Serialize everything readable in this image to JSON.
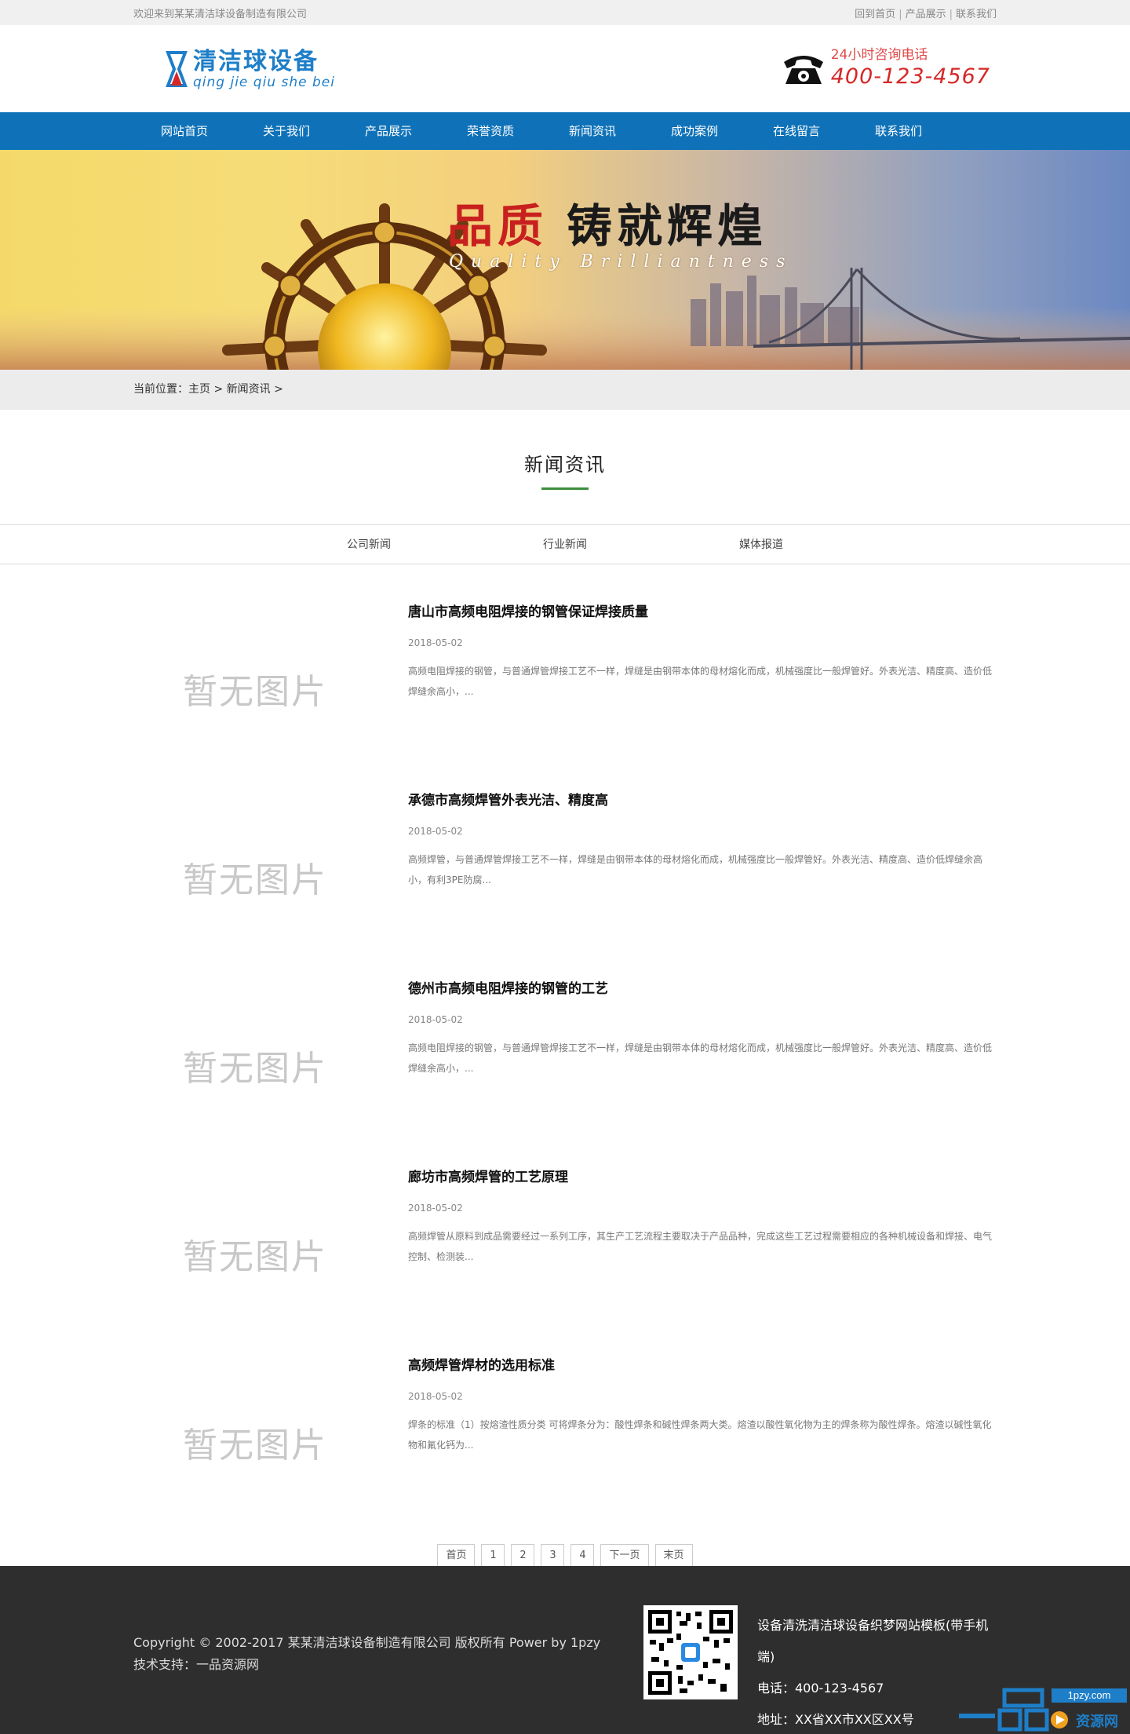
{
  "topbar": {
    "welcome": "欢迎来到某某清洁球设备制造有限公司",
    "links": [
      "回到首页",
      "产品展示",
      "联系我们"
    ]
  },
  "header": {
    "logo_cn": "清洁球设备",
    "logo_pinyin": "qing jie qiu she bei",
    "hotline_label": "24小时咨询电话",
    "hotline_number": "400-123-4567"
  },
  "nav": [
    "网站首页",
    "关于我们",
    "产品展示",
    "荣誉资质",
    "新闻资讯",
    "成功案例",
    "在线留言",
    "联系我们"
  ],
  "banner": {
    "title_red": "品质",
    "title_black": "铸就辉煌",
    "subtitle_en": "Quality Brilliantness"
  },
  "breadcrumb": "当前位置：主页 > 新闻资讯 >",
  "section": {
    "title": "新闻资讯"
  },
  "tabs": [
    "公司新闻",
    "行业新闻",
    "媒体报道"
  ],
  "news": [
    {
      "thumb": "暂无图片",
      "title": "唐山市高频电阻焊接的钢管保证焊接质量",
      "date": "2018-05-02",
      "desc": "高频电阻焊接的钢管，与普通焊管焊接工艺不一样，焊缝是由钢带本体的母材熔化而成，机械强度比一般焊管好。外表光洁、精度高、造价低焊缝余高小，..."
    },
    {
      "thumb": "暂无图片",
      "title": "承德市高频焊管外表光洁、精度高",
      "date": "2018-05-02",
      "desc": "高频焊管，与普通焊管焊接工艺不一样，焊缝是由钢带本体的母材熔化而成，机械强度比一般焊管好。外表光洁、精度高、造价低焊缝余高小，有利3PE防腐..."
    },
    {
      "thumb": "暂无图片",
      "title": "德州市高频电阻焊接的钢管的工艺",
      "date": "2018-05-02",
      "desc": "高频电阻焊接的钢管，与普通焊管焊接工艺不一样，焊缝是由钢带本体的母材熔化而成，机械强度比一般焊管好。外表光洁、精度高、造价低焊缝余高小，..."
    },
    {
      "thumb": "暂无图片",
      "title": "廊坊市高频焊管的工艺原理",
      "date": "2018-05-02",
      "desc": "高频焊管从原料到成品需要经过一系列工序，其生产工艺流程主要取决于产品品种，完成这些工艺过程需要相应的各种机械设备和焊接、电气控制、检测装..."
    },
    {
      "thumb": "暂无图片",
      "title": "高频焊管焊材的选用标准",
      "date": "2018-05-02",
      "desc": "焊条的标准（1）按熔渣性质分类 可将焊条分为：酸性焊条和碱性焊条两大类。熔渣以酸性氧化物为主的焊条称为酸性焊条。熔渣以碱性氧化物和氟化钙为..."
    }
  ],
  "pagination": {
    "first": "首页",
    "pages": [
      "1",
      "2",
      "3",
      "4"
    ],
    "next": "下一页",
    "last": "末页"
  },
  "footer": {
    "copyright": "Copyright © 2002-2017 某某清洁球设备制造有限公司 版权所有 Power by 1pzy",
    "support": "技术支持：一品资源网",
    "site_name": "设备清洗清洁球设备织梦网站模板(带手机端)",
    "phone": "电话：400-123-4567",
    "address": "地址：XX省XX市XX区XX号",
    "badge_url": "1pzy.com",
    "badge_text": "资源网"
  },
  "colors": {
    "nav_bg": "#0f72b8",
    "accent_green": "#3c8e3c",
    "hotline_red": "#d62828",
    "footer_bg": "#2e2e2e"
  }
}
